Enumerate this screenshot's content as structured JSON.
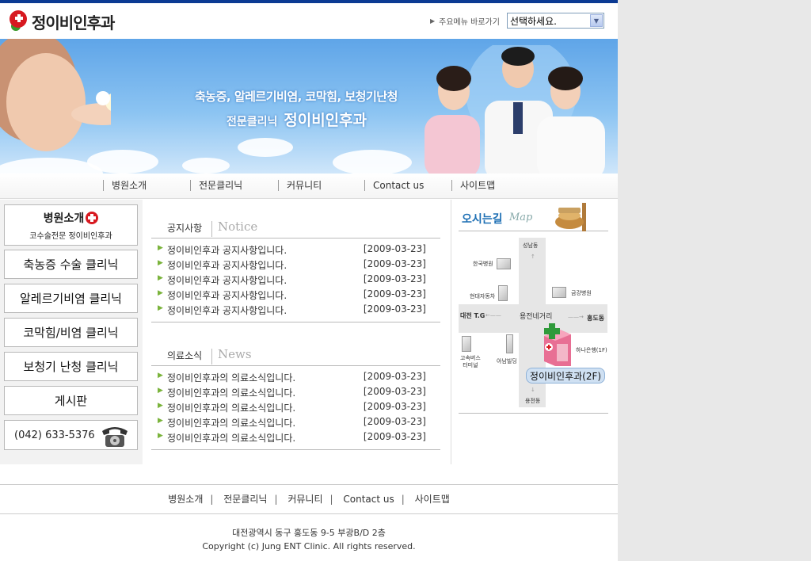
{
  "header": {
    "logo_text": "정이비인후과",
    "quicknav_label": "주요메뉴 바로가기",
    "quicknav_selected": "선택하세요."
  },
  "banner": {
    "title": "축농증, 알레르기비염, 코막힘, 보청기난청",
    "sub_prefix": "전문클리닉",
    "sub_name": "정이비인후과"
  },
  "gnb": {
    "items": [
      "병원소개",
      "전문클리닉",
      "커뮤니티",
      "Contact us",
      "사이트맵"
    ]
  },
  "lnb": {
    "intro_title": "병원소개",
    "intro_sub": "코수술전문 정이비인후과",
    "menu": [
      "축농증 수술 클리닉",
      "알레르기비염 클리닉",
      "코막힘/비염 클리닉",
      "보청기 난청 클리닉",
      "게시판"
    ],
    "phone": "(042) 633-5376"
  },
  "notice": {
    "title_kr": "공지사항",
    "title_en": "Notice",
    "items": [
      {
        "title": "정이비인후과 공지사항입니다.",
        "date": "[2009-03-23]"
      },
      {
        "title": "정이비인후과 공지사항입니다.",
        "date": "[2009-03-23]"
      },
      {
        "title": "정이비인후과 공지사항입니다.",
        "date": "[2009-03-23]"
      },
      {
        "title": "정이비인후과 공지사항입니다.",
        "date": "[2009-03-23]"
      },
      {
        "title": "정이비인후과 공지사항입니다.",
        "date": "[2009-03-23]"
      }
    ]
  },
  "news": {
    "title_kr": "의료소식",
    "title_en": "News",
    "items": [
      {
        "title": "정이비인후과의 의료소식입니다.",
        "date": "[2009-03-23]"
      },
      {
        "title": "정이비인후과의 의료소식입니다.",
        "date": "[2009-03-23]"
      },
      {
        "title": "정이비인후과의 의료소식입니다.",
        "date": "[2009-03-23]"
      },
      {
        "title": "정이비인후과의 의료소식입니다.",
        "date": "[2009-03-23]"
      },
      {
        "title": "정이비인후과의 의료소식입니다.",
        "date": "[2009-03-23]"
      }
    ]
  },
  "map": {
    "title_kr": "오시는길",
    "title_en": "Map",
    "labels": {
      "north": "성남동",
      "korea_hospital": "한국병원",
      "hyundai": "현대자동차",
      "geumgang": "금강병원",
      "west": "대전 T.G",
      "center": "용전네거리",
      "east": "홍도동",
      "bus_terminal": "고속버스\n터미널",
      "anam": "아남빌딩",
      "hana": "하나은행(1F)",
      "south": "용전동"
    },
    "hospital_label": "정이비인후과(2F)"
  },
  "footer": {
    "nav": [
      "병원소개",
      "전문클리닉",
      "커뮤니티",
      "Contact us",
      "사이트맵"
    ],
    "address": "대전광역시 동구 홍도동 9-5 부광B/D 2층",
    "copyright": "Copyright (c) Jung ENT Clinic. All rights reserved."
  },
  "colors": {
    "topbar": "#0b3a93",
    "brand_red": "#d71920",
    "brand_green": "#3a9a2c",
    "bullet_green": "#7ab33b",
    "map_title_blue": "#1d6fb4"
  },
  "icons": [
    "logo-mark-icon",
    "phone-icon",
    "arrow-icon",
    "select-dropdown-icon",
    "map-sign-icon"
  ]
}
